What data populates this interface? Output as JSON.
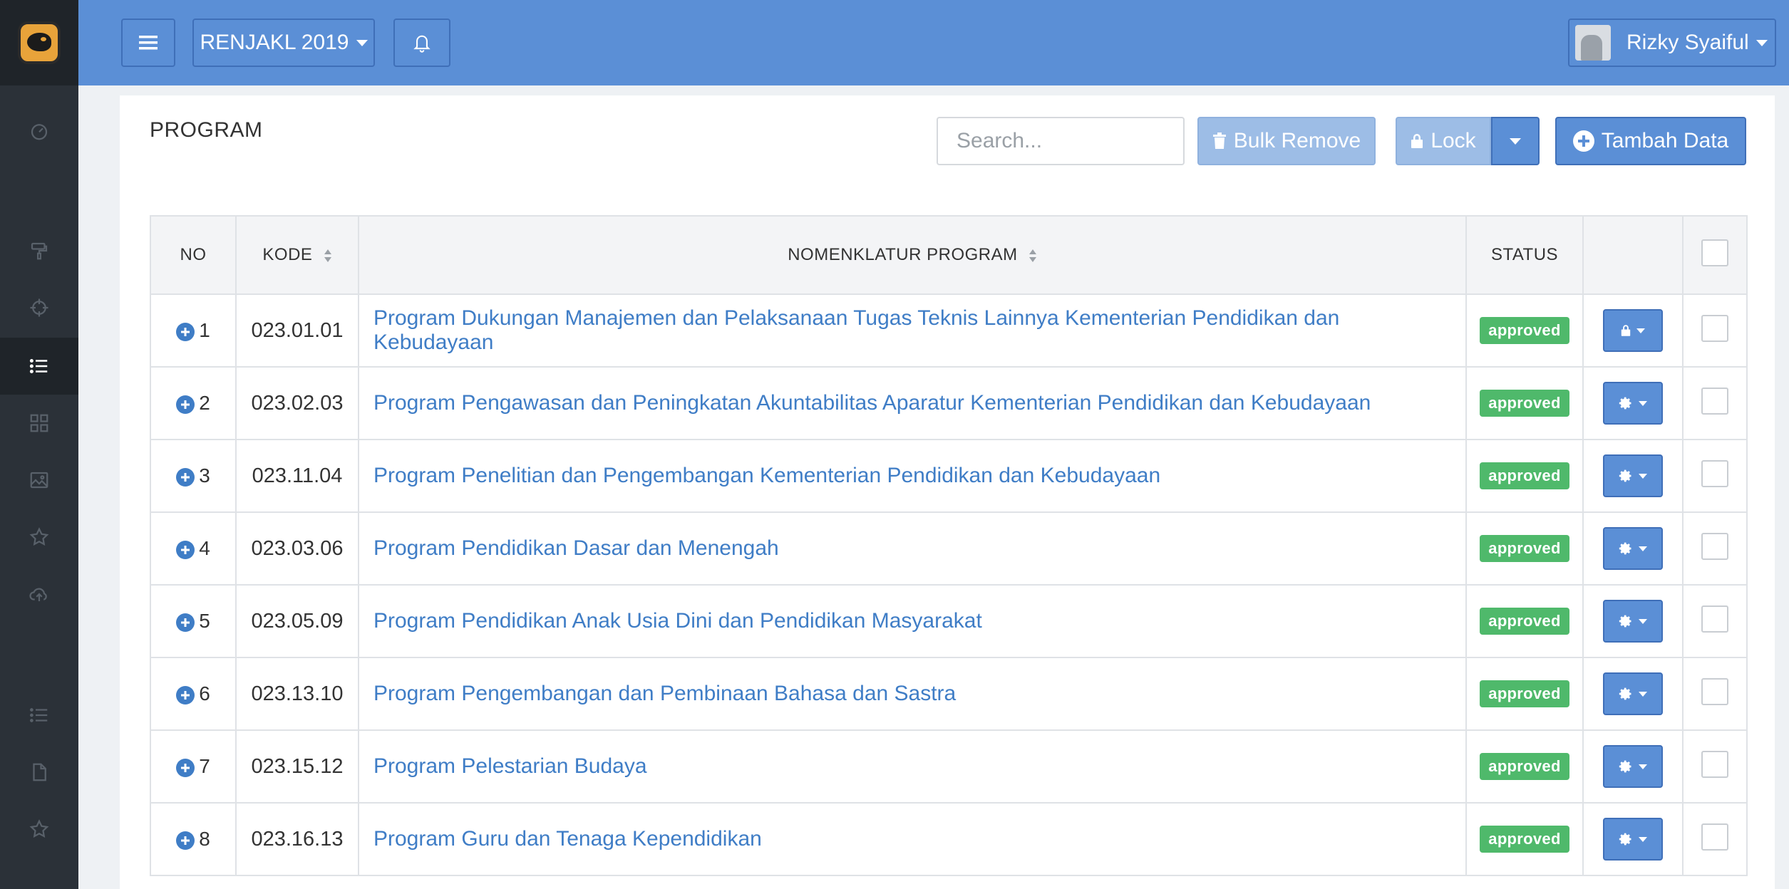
{
  "topbar": {
    "year_label": "RENJAKL 2019",
    "user_name": "Rizky Syaiful"
  },
  "sidebar": {
    "icons": [
      "dashboard-icon",
      "paint-roller-icon",
      "crosshair-icon",
      "list-icon",
      "grid-icon",
      "image-icon",
      "star-icon",
      "cloud-upload-icon",
      "list-icon",
      "file-icon",
      "star-icon"
    ],
    "active_index": 3
  },
  "page": {
    "title": "PROGRAM",
    "search_placeholder": "Search...",
    "bulk_remove_label": "Bulk Remove",
    "lock_label": "Lock",
    "add_label": "Tambah Data"
  },
  "table": {
    "headers": {
      "no": "NO",
      "kode": "KODE",
      "nomenklatur": "NOMENKLATUR PROGRAM",
      "status": "STATUS"
    },
    "rows": [
      {
        "no": "1",
        "kode": "023.01.01",
        "name": "Program Dukungan Manajemen dan Pelaksanaan Tugas Teknis Lainnya Kementerian Pendidikan dan Kebudayaan",
        "status": "approved",
        "action": "lock"
      },
      {
        "no": "2",
        "kode": "023.02.03",
        "name": "Program Pengawasan dan Peningkatan Akuntabilitas Aparatur Kementerian Pendidikan dan Kebudayaan",
        "status": "approved",
        "action": "gear"
      },
      {
        "no": "3",
        "kode": "023.11.04",
        "name": "Program Penelitian dan Pengembangan Kementerian Pendidikan dan Kebudayaan",
        "status": "approved",
        "action": "gear"
      },
      {
        "no": "4",
        "kode": "023.03.06",
        "name": "Program Pendidikan Dasar dan Menengah",
        "status": "approved",
        "action": "gear"
      },
      {
        "no": "5",
        "kode": "023.05.09",
        "name": "Program Pendidikan Anak Usia Dini dan Pendidikan Masyarakat",
        "status": "approved",
        "action": "gear"
      },
      {
        "no": "6",
        "kode": "023.13.10",
        "name": "Program Pengembangan dan Pembinaan Bahasa dan Sastra",
        "status": "approved",
        "action": "gear"
      },
      {
        "no": "7",
        "kode": "023.15.12",
        "name": "Program Pelestarian Budaya",
        "status": "approved",
        "action": "gear"
      },
      {
        "no": "8",
        "kode": "023.16.13",
        "name": "Program Guru dan Tenaga Kependidikan",
        "status": "approved",
        "action": "gear"
      }
    ]
  },
  "colors": {
    "topbar": "#5b8fd6",
    "sidebar": "#2b3138",
    "link": "#3f7dc6",
    "badge_approved": "#4fb96b"
  }
}
